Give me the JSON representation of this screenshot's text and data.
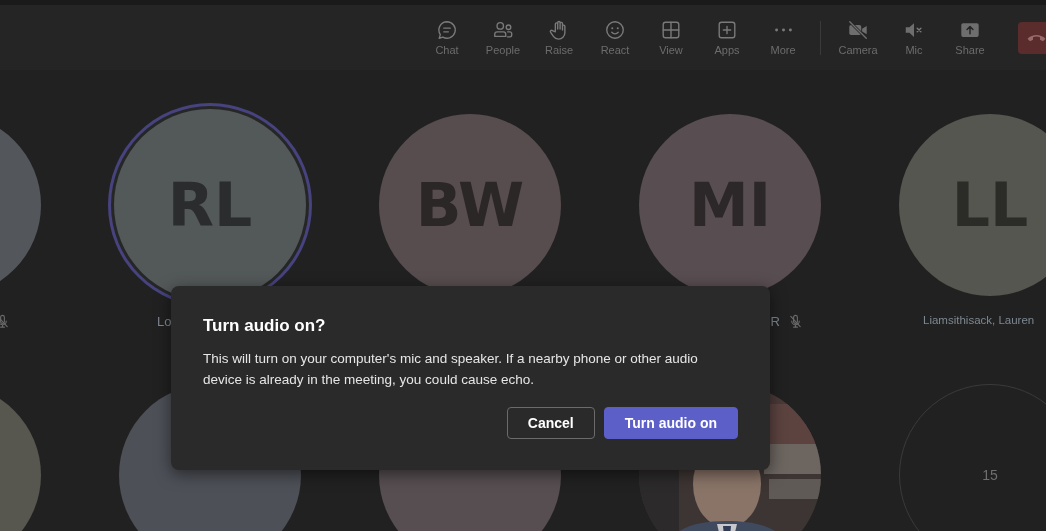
{
  "toolbar": {
    "items": [
      {
        "label": "Chat"
      },
      {
        "label": "People"
      },
      {
        "label": "Raise"
      },
      {
        "label": "React"
      },
      {
        "label": "View"
      },
      {
        "label": "Apps"
      },
      {
        "label": "More"
      },
      {
        "label": "Camera"
      },
      {
        "label": "Mic"
      },
      {
        "label": "Share"
      }
    ],
    "leave": {
      "kind": "leave"
    }
  },
  "participants": [
    {
      "kind": "avatar",
      "color": "#53575c",
      "muted": true
    },
    {
      "kind": "avatar",
      "initials": "RL",
      "name": "Lo",
      "color": "#535859",
      "speaking": true
    },
    {
      "kind": "avatar",
      "initials": "BW",
      "color": "#574d4e"
    },
    {
      "kind": "avatar",
      "initials": "MI",
      "name": "R",
      "color": "#584d50",
      "muted": true
    },
    {
      "kind": "avatar",
      "initials": "LL",
      "name": "Liamsithisack, Lauren",
      "color": "#555650"
    },
    {
      "kind": "avatar",
      "color": "#575750"
    },
    {
      "kind": "avatar",
      "color": "#4d5057"
    },
    {
      "kind": "avatar",
      "color": "#574e51"
    },
    {
      "kind": "picture"
    },
    {
      "kind": "overflow",
      "count": "15"
    }
  ],
  "dialog": {
    "title": "Turn audio on?",
    "message": "This will turn on your computer's mic and speaker. If a nearby phone or other audio device is already in the meeting, you could cause echo.",
    "buttons": [
      {
        "label": "Cancel",
        "primary": false
      },
      {
        "label": "Turn audio on",
        "primary": true
      }
    ]
  }
}
